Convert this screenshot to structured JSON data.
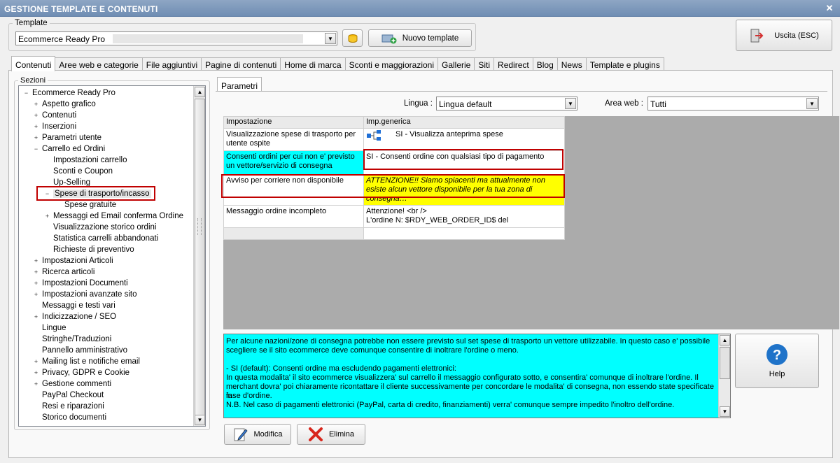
{
  "window": {
    "title": "GESTIONE TEMPLATE E CONTENUTI",
    "close_label": "✕"
  },
  "template": {
    "group_label": "Template",
    "selected": "Ecommerce Ready Pro",
    "new_button": "Nuovo template"
  },
  "exit_button": "Uscita (ESC)",
  "tabs": [
    "Contenuti",
    "Aree web e categorie",
    "File aggiuntivi",
    "Pagine di contenuti",
    "Home di marca",
    "Sconti e maggiorazioni",
    "Gallerie",
    "Siti",
    "Redirect",
    "Blog",
    "News",
    "Template e plugins"
  ],
  "sections": {
    "label": "Sezioni",
    "items": [
      {
        "label": "Ecommerce Ready Pro",
        "level": 0,
        "toggle": "−"
      },
      {
        "label": "Aspetto grafico",
        "level": 1,
        "toggle": "+"
      },
      {
        "label": "Contenuti",
        "level": 1,
        "toggle": "+"
      },
      {
        "label": "Inserzioni",
        "level": 1,
        "toggle": "+"
      },
      {
        "label": "Parametri utente",
        "level": 1,
        "toggle": "+"
      },
      {
        "label": "Carrello ed Ordini",
        "level": 1,
        "toggle": "−"
      },
      {
        "label": "Impostazioni carrello",
        "level": 2,
        "toggle": ""
      },
      {
        "label": "Sconti e Coupon",
        "level": 2,
        "toggle": ""
      },
      {
        "label": "Up-Selling",
        "level": 2,
        "toggle": ""
      },
      {
        "label": "Spese di trasporto/incasso",
        "level": 2,
        "toggle": "−",
        "selected": true
      },
      {
        "label": "Spese gratuite",
        "level": 3,
        "toggle": ""
      },
      {
        "label": "Messaggi ed Email conferma Ordine",
        "level": 2,
        "toggle": "+"
      },
      {
        "label": "Visualizzazione storico ordini",
        "level": 2,
        "toggle": ""
      },
      {
        "label": "Statistica carrelli abbandonati",
        "level": 2,
        "toggle": ""
      },
      {
        "label": "Richieste di preventivo",
        "level": 2,
        "toggle": ""
      },
      {
        "label": "Impostazioni Articoli",
        "level": 1,
        "toggle": "+"
      },
      {
        "label": "Ricerca articoli",
        "level": 1,
        "toggle": "+"
      },
      {
        "label": "Impostazioni Documenti",
        "level": 1,
        "toggle": "+"
      },
      {
        "label": "Impostazioni avanzate sito",
        "level": 1,
        "toggle": "+"
      },
      {
        "label": "Messaggi e testi vari",
        "level": 1,
        "toggle": ""
      },
      {
        "label": "Indicizzazione / SEO",
        "level": 1,
        "toggle": "+"
      },
      {
        "label": "Lingue",
        "level": 1,
        "toggle": ""
      },
      {
        "label": "Stringhe/Traduzioni",
        "level": 1,
        "toggle": ""
      },
      {
        "label": "Pannello amministrativo",
        "level": 1,
        "toggle": ""
      },
      {
        "label": "Mailing list e notifiche email",
        "level": 1,
        "toggle": "+"
      },
      {
        "label": "Privacy, GDPR e Cookie",
        "level": 1,
        "toggle": "+"
      },
      {
        "label": "Gestione commenti",
        "level": 1,
        "toggle": "+"
      },
      {
        "label": "PayPal Checkout",
        "level": 1,
        "toggle": ""
      },
      {
        "label": "Resi e riparazioni",
        "level": 1,
        "toggle": ""
      },
      {
        "label": "Storico documenti",
        "level": 1,
        "toggle": ""
      }
    ]
  },
  "params_tab": "Parametri",
  "filters": {
    "lingua_label": "Lingua :",
    "lingua_value": "Lingua default",
    "area_label": "Area web :",
    "area_value": "Tutti"
  },
  "grid": {
    "headers": [
      "Impostazione",
      "Imp.generica"
    ],
    "rows": [
      {
        "setting": "Visualizzazione spese di trasporto per utente ospite",
        "value": "SI - Visualizza anteprima spese"
      },
      {
        "setting": "Consenti ordini per cui non e' previsto un vettore/servizio di consegna",
        "value": "SI - Consenti ordine con qualsiasi tipo di pagamento"
      },
      {
        "setting": "Avviso per corriere non disponibile",
        "value": "ATTENZIONE!! Siamo spiacenti ma attualmente non esiste alcun vettore disponibile per la tua zona di consegna…"
      },
      {
        "setting": "Messaggio ordine incompleto",
        "value_line1": "Attenzione! <br />",
        "value_line2": "L'ordine N: $RDY_WEB_ORDER_ID$ del"
      }
    ]
  },
  "description": {
    "line1": "Per alcune nazioni/zone di consegna potrebbe non essere previsto sul set spese di trasporto un vettore utilizzabile. In questo caso e' possibile",
    "line2": "scegliere se il sito ecommerce deve comunque consentire di inoltrare l'ordine o meno.",
    "line3": "- SI (default): Consenti ordine ma escludendo pagamenti  elettronici:",
    "line4": "In questa modalita' il sito ecommerce visualizzera' sul carrello il messaggio configurato sotto, e consentira' comunque di inoltrare l'ordine. Il",
    "line5": "merchant dovra' poi chiaramente ricontattare il cliente successivamente per concordare le modalita' di consegna, non essendo state specificate in",
    "line6": "fase d'ordine.",
    "line7": "N.B. Nel caso di pagamenti elettronici (PayPal, carta di credito, finanziamenti) verra' comunque sempre impedito l'inoltro dell'ordine."
  },
  "buttons": {
    "help": "Help",
    "modify": "Modifica",
    "delete": "Elimina"
  },
  "colors": {
    "title_bar": "#7a96ba",
    "highlight_cyan": "#00ffff",
    "warning_yellow": "#ffff00",
    "red_box": "#c00000",
    "help_blue": "#1f73c9"
  }
}
